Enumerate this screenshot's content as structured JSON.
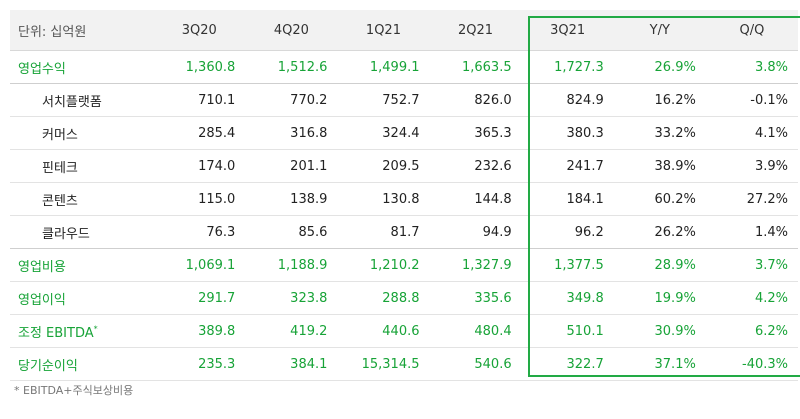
{
  "header": [
    "단위: 십억원",
    "3Q20",
    "4Q20",
    "1Q21",
    "2Q21",
    "3Q21",
    "Y/Y",
    "Q/Q"
  ],
  "rows": [
    {
      "label": "영업수익",
      "values": [
        "1,360.8",
        "1,512.6",
        "1,499.1",
        "1,663.5",
        "1,727.3",
        "26.9%",
        "3.8%"
      ],
      "sup": ""
    },
    {
      "label": "서치플랫폼",
      "values": [
        "710.1",
        "770.2",
        "752.7",
        "826.0",
        "824.9",
        "16.2%",
        "-0.1%"
      ],
      "sup": ""
    },
    {
      "label": "커머스",
      "values": [
        "285.4",
        "316.8",
        "324.4",
        "365.3",
        "380.3",
        "33.2%",
        "4.1%"
      ],
      "sup": ""
    },
    {
      "label": "핀테크",
      "values": [
        "174.0",
        "201.1",
        "209.5",
        "232.6",
        "241.7",
        "38.9%",
        "3.9%"
      ],
      "sup": ""
    },
    {
      "label": "콘텐츠",
      "values": [
        "115.0",
        "138.9",
        "130.8",
        "144.8",
        "184.1",
        "60.2%",
        "27.2%"
      ],
      "sup": ""
    },
    {
      "label": "클라우드",
      "values": [
        "76.3",
        "85.6",
        "81.7",
        "94.9",
        "96.2",
        "26.2%",
        "1.4%"
      ],
      "sup": ""
    },
    {
      "label": "영업비용",
      "values": [
        "1,069.1",
        "1,188.9",
        "1,210.2",
        "1,327.9",
        "1,377.5",
        "28.9%",
        "3.7%"
      ],
      "sup": ""
    },
    {
      "label": "영업이익",
      "values": [
        "291.7",
        "323.8",
        "288.8",
        "335.6",
        "349.8",
        "19.9%",
        "4.2%"
      ],
      "sup": ""
    },
    {
      "label": "조정 EBITDA",
      "values": [
        "389.8",
        "419.2",
        "440.6",
        "480.4",
        "510.1",
        "30.9%",
        "6.2%"
      ],
      "sup": "*"
    },
    {
      "label": "당기순이익",
      "values": [
        "235.3",
        "384.1",
        "15,314.5",
        "540.6",
        "322.7",
        "37.1%",
        "-40.3%"
      ],
      "sup": ""
    }
  ],
  "footnote": "* EBITDA+주식보상비용",
  "colors": {
    "green": "#17a337",
    "highlight_border": "#22aa45",
    "header_bg": "#f2f2f2"
  }
}
